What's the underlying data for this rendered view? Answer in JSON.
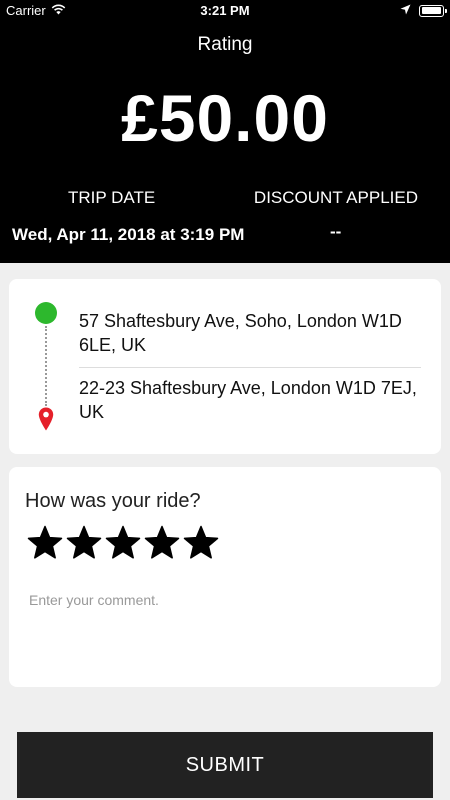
{
  "status_bar": {
    "carrier": "Carrier",
    "time": "3:21 PM",
    "icons": [
      "wifi-icon",
      "location-arrow-icon",
      "battery-icon"
    ]
  },
  "header": {
    "title": "Rating",
    "amount": "£50.00",
    "trip_date_label": "TRIP DATE",
    "trip_date_value": "Wed, Apr 11, 2018 at 3:19 PM",
    "discount_label": "DISCOUNT APPLIED",
    "discount_value": "--"
  },
  "route": {
    "pickup_address": "57 Shaftesbury Ave,  Soho,  London W1D 6LE,  UK",
    "dropoff_address": "22-23 Shaftesbury Ave,  London W1D 7EJ,  UK",
    "pickup_color": "#2db82d",
    "dropoff_color": "#e5202a"
  },
  "rating": {
    "question": "How was your ride?",
    "stars_total": 5,
    "stars_selected": 5,
    "comment_placeholder": "Enter your comment.",
    "comment_value": ""
  },
  "actions": {
    "submit_label": "SUBMIT"
  },
  "colors": {
    "header_bg": "#000000",
    "page_bg": "#efefef",
    "submit_bg": "#222222"
  }
}
